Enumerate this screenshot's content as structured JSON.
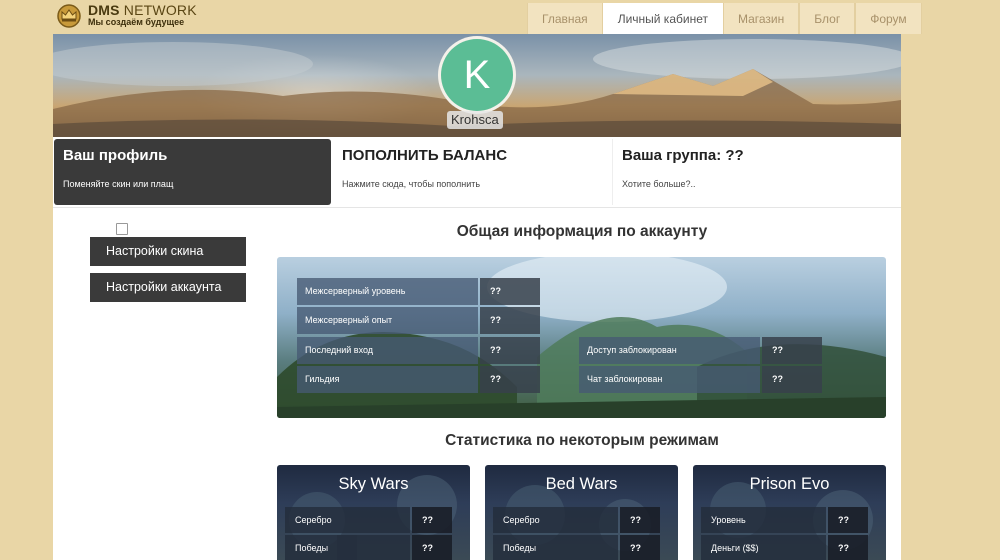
{
  "logo": {
    "title_main": "DMS",
    "title_rest": " NETWORK",
    "subtitle": "Мы создаём будущее",
    "icon": "crown-emblem-icon"
  },
  "nav": [
    "Главная",
    "Личный кабинет",
    "Магазин",
    "Блог",
    "Форум"
  ],
  "nav_active": "Личный кабинет",
  "profile": {
    "avatar_letter": "K",
    "avatar_color": "#5bbd95",
    "username": "Krohsca"
  },
  "cards": {
    "profile": {
      "title": "Ваш профиль",
      "sub": "Поменяйте скин или плащ"
    },
    "balance": {
      "title": "ПОПОЛНИТЬ БАЛАНС",
      "sub": "Нажмите сюда, чтобы пополнить"
    },
    "group": {
      "title": "Ваша группа: ??",
      "sub": "Хотите больше?.."
    }
  },
  "sidebar": {
    "skin_btn": "Настройки скина",
    "account_btn": "Настройки аккаунта"
  },
  "account_info": {
    "heading": "Общая информация по аккаунту",
    "left": [
      {
        "label": "Межсерверный уровень",
        "value": "??"
      },
      {
        "label": "Межсерверный опыт",
        "value": "??"
      },
      {
        "label": "Последний вход",
        "value": "??"
      },
      {
        "label": "Гильдия",
        "value": "??"
      }
    ],
    "right": [
      {
        "label": "Доступ заблокирован",
        "value": "??"
      },
      {
        "label": "Чат заблокирован",
        "value": "??"
      }
    ]
  },
  "stats": {
    "heading": "Статистика по некоторым режимам",
    "modes": [
      {
        "title": "Sky Wars",
        "rows": [
          {
            "label": "Серебро",
            "value": "??"
          },
          {
            "label": "Победы",
            "value": "??"
          }
        ]
      },
      {
        "title": "Bed Wars",
        "rows": [
          {
            "label": "Серебро",
            "value": "??"
          },
          {
            "label": "Победы",
            "value": "??"
          }
        ]
      },
      {
        "title": "Prison Evo",
        "rows": [
          {
            "label": "Уровень",
            "value": "??"
          },
          {
            "label": "Деньги ($$)",
            "value": "??"
          }
        ]
      }
    ]
  },
  "colors": {
    "header_bg": "#e9d6a6",
    "dark_button": "#3a3a3a",
    "accent_green": "#5bbd95"
  }
}
